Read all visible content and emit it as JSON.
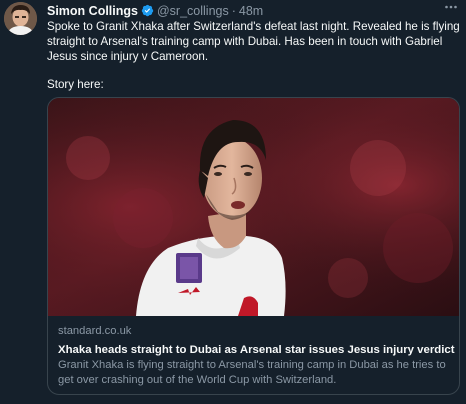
{
  "tweet": {
    "author_name": "Simon Collings",
    "handle": "@sr_collings",
    "separator": "·",
    "timestamp": "48m",
    "more_icon": "more-icon",
    "verified_icon": "verified-badge-icon",
    "body_lines": [
      "Spoke to Granit Xhaka after Switzerland's defeat last night. Revealed he is flying",
      "straight to Arsenal's training camp with Dubai. Has been in touch with Gabriel",
      "Jesus since injury v Cameroon."
    ],
    "story_label": "Story here:",
    "card": {
      "domain": "standard.co.uk",
      "title": "Xhaka heads straight to Dubai as Arsenal star issues Jesus injury verdict",
      "description_lines": [
        "Granit Xhaka is flying straight to Arsenal's training camp in Dubai as he tries to",
        "get over crashing out of the World Cup with Switzerland."
      ]
    }
  },
  "colors": {
    "background": "#15202b",
    "primary_text": "#f7f9f9",
    "secondary_text": "#8b98a5",
    "border": "#38444d",
    "verified_blue": "#1d9bf0",
    "stadium_red": "#7a1420"
  }
}
